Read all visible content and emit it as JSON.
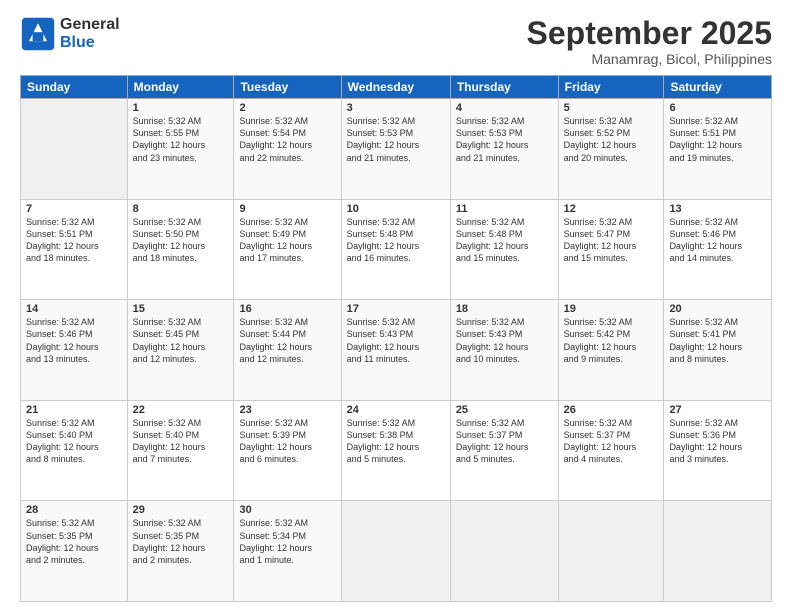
{
  "logo": {
    "line1": "General",
    "line2": "Blue"
  },
  "title": "September 2025",
  "subtitle": "Manamrag, Bicol, Philippines",
  "header": {
    "days": [
      "Sunday",
      "Monday",
      "Tuesday",
      "Wednesday",
      "Thursday",
      "Friday",
      "Saturday"
    ]
  },
  "weeks": [
    [
      {
        "day": "",
        "info": ""
      },
      {
        "day": "1",
        "info": "Sunrise: 5:32 AM\nSunset: 5:55 PM\nDaylight: 12 hours\nand 23 minutes."
      },
      {
        "day": "2",
        "info": "Sunrise: 5:32 AM\nSunset: 5:54 PM\nDaylight: 12 hours\nand 22 minutes."
      },
      {
        "day": "3",
        "info": "Sunrise: 5:32 AM\nSunset: 5:53 PM\nDaylight: 12 hours\nand 21 minutes."
      },
      {
        "day": "4",
        "info": "Sunrise: 5:32 AM\nSunset: 5:53 PM\nDaylight: 12 hours\nand 21 minutes."
      },
      {
        "day": "5",
        "info": "Sunrise: 5:32 AM\nSunset: 5:52 PM\nDaylight: 12 hours\nand 20 minutes."
      },
      {
        "day": "6",
        "info": "Sunrise: 5:32 AM\nSunset: 5:51 PM\nDaylight: 12 hours\nand 19 minutes."
      }
    ],
    [
      {
        "day": "7",
        "info": "Sunrise: 5:32 AM\nSunset: 5:51 PM\nDaylight: 12 hours\nand 18 minutes."
      },
      {
        "day": "8",
        "info": "Sunrise: 5:32 AM\nSunset: 5:50 PM\nDaylight: 12 hours\nand 18 minutes."
      },
      {
        "day": "9",
        "info": "Sunrise: 5:32 AM\nSunset: 5:49 PM\nDaylight: 12 hours\nand 17 minutes."
      },
      {
        "day": "10",
        "info": "Sunrise: 5:32 AM\nSunset: 5:48 PM\nDaylight: 12 hours\nand 16 minutes."
      },
      {
        "day": "11",
        "info": "Sunrise: 5:32 AM\nSunset: 5:48 PM\nDaylight: 12 hours\nand 15 minutes."
      },
      {
        "day": "12",
        "info": "Sunrise: 5:32 AM\nSunset: 5:47 PM\nDaylight: 12 hours\nand 15 minutes."
      },
      {
        "day": "13",
        "info": "Sunrise: 5:32 AM\nSunset: 5:46 PM\nDaylight: 12 hours\nand 14 minutes."
      }
    ],
    [
      {
        "day": "14",
        "info": "Sunrise: 5:32 AM\nSunset: 5:46 PM\nDaylight: 12 hours\nand 13 minutes."
      },
      {
        "day": "15",
        "info": "Sunrise: 5:32 AM\nSunset: 5:45 PM\nDaylight: 12 hours\nand 12 minutes."
      },
      {
        "day": "16",
        "info": "Sunrise: 5:32 AM\nSunset: 5:44 PM\nDaylight: 12 hours\nand 12 minutes."
      },
      {
        "day": "17",
        "info": "Sunrise: 5:32 AM\nSunset: 5:43 PM\nDaylight: 12 hours\nand 11 minutes."
      },
      {
        "day": "18",
        "info": "Sunrise: 5:32 AM\nSunset: 5:43 PM\nDaylight: 12 hours\nand 10 minutes."
      },
      {
        "day": "19",
        "info": "Sunrise: 5:32 AM\nSunset: 5:42 PM\nDaylight: 12 hours\nand 9 minutes."
      },
      {
        "day": "20",
        "info": "Sunrise: 5:32 AM\nSunset: 5:41 PM\nDaylight: 12 hours\nand 8 minutes."
      }
    ],
    [
      {
        "day": "21",
        "info": "Sunrise: 5:32 AM\nSunset: 5:40 PM\nDaylight: 12 hours\nand 8 minutes."
      },
      {
        "day": "22",
        "info": "Sunrise: 5:32 AM\nSunset: 5:40 PM\nDaylight: 12 hours\nand 7 minutes."
      },
      {
        "day": "23",
        "info": "Sunrise: 5:32 AM\nSunset: 5:39 PM\nDaylight: 12 hours\nand 6 minutes."
      },
      {
        "day": "24",
        "info": "Sunrise: 5:32 AM\nSunset: 5:38 PM\nDaylight: 12 hours\nand 5 minutes."
      },
      {
        "day": "25",
        "info": "Sunrise: 5:32 AM\nSunset: 5:37 PM\nDaylight: 12 hours\nand 5 minutes."
      },
      {
        "day": "26",
        "info": "Sunrise: 5:32 AM\nSunset: 5:37 PM\nDaylight: 12 hours\nand 4 minutes."
      },
      {
        "day": "27",
        "info": "Sunrise: 5:32 AM\nSunset: 5:36 PM\nDaylight: 12 hours\nand 3 minutes."
      }
    ],
    [
      {
        "day": "28",
        "info": "Sunrise: 5:32 AM\nSunset: 5:35 PM\nDaylight: 12 hours\nand 2 minutes."
      },
      {
        "day": "29",
        "info": "Sunrise: 5:32 AM\nSunset: 5:35 PM\nDaylight: 12 hours\nand 2 minutes."
      },
      {
        "day": "30",
        "info": "Sunrise: 5:32 AM\nSunset: 5:34 PM\nDaylight: 12 hours\nand 1 minute."
      },
      {
        "day": "",
        "info": ""
      },
      {
        "day": "",
        "info": ""
      },
      {
        "day": "",
        "info": ""
      },
      {
        "day": "",
        "info": ""
      }
    ]
  ]
}
